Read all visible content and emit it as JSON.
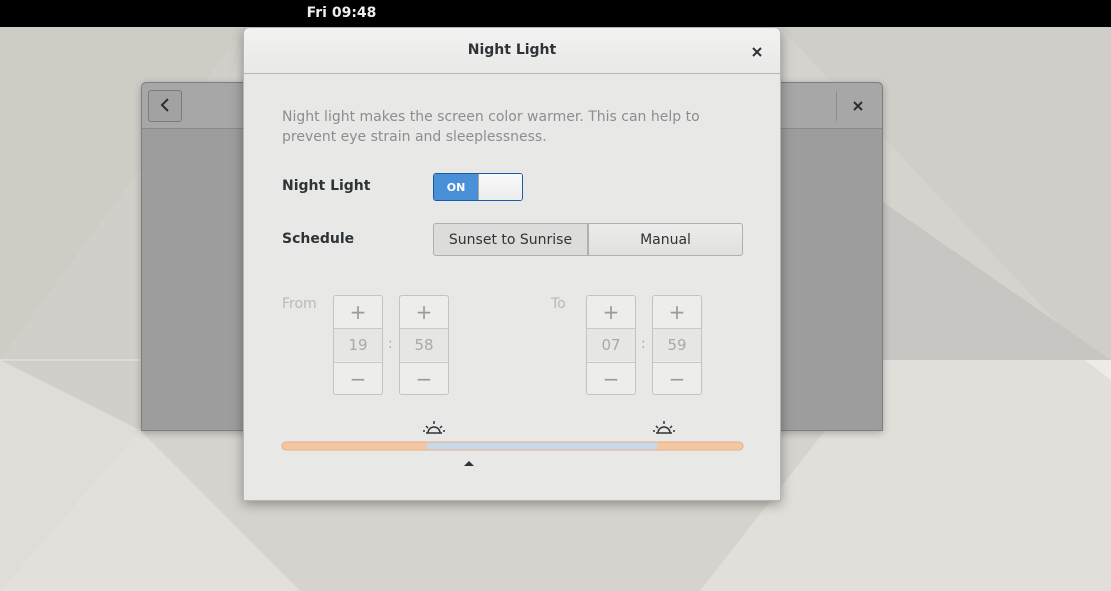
{
  "topbar": {
    "clock": "Fri 09:48"
  },
  "background_window": {
    "back_icon": "chevron-left-icon",
    "close_icon": "close-icon"
  },
  "dialog": {
    "title": "Night Light",
    "close_icon": "close-icon",
    "description": "Night light makes the screen color warmer. This can help to prevent eye strain and sleeplessness.",
    "night_light": {
      "label": "Night Light",
      "switch_text": "ON",
      "state": true
    },
    "schedule": {
      "label": "Schedule",
      "options": [
        "Sunset to Sunrise",
        "Manual"
      ],
      "selected": "Sunset to Sunrise"
    },
    "from": {
      "label": "From",
      "hours": "19",
      "minutes": "58",
      "separator": ":"
    },
    "to": {
      "label": "To",
      "hours": "07",
      "minutes": "59",
      "separator": ":"
    },
    "spin": {
      "plus": "+",
      "minus": "−"
    },
    "timeline": {
      "sunset_icon": "sunset-icon",
      "sunrise_icon": "sunrise-icon",
      "current_time_marker": "triangle-up-icon",
      "colors": {
        "night": "#f5c7a0",
        "day": "#c9d9ea"
      }
    }
  }
}
